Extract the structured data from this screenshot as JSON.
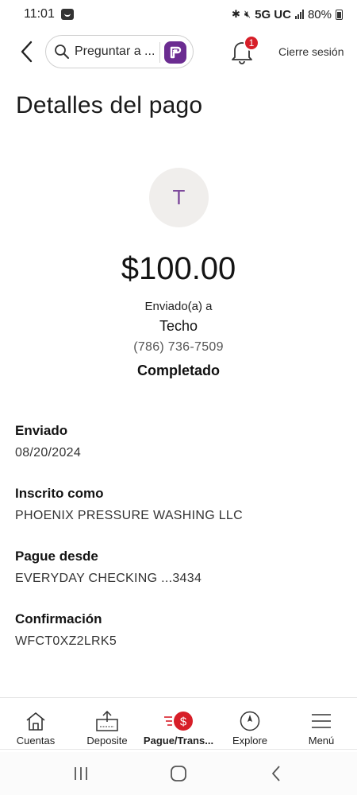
{
  "status_bar": {
    "time": "11:01",
    "network": "5G UC",
    "battery": "80%"
  },
  "app_bar": {
    "search_placeholder": "Preguntar a ...",
    "notification_count": "1",
    "signout_label": "Cierre sesión"
  },
  "page": {
    "title": "Detalles del pago"
  },
  "payment": {
    "avatar_initial": "T",
    "amount": "$100.00",
    "sent_to_label": "Enviado(a) a",
    "recipient_name": "Techo",
    "recipient_phone": "(786) 736-7509",
    "status": "Completado"
  },
  "details": [
    {
      "label": "Enviado",
      "value": "08/20/2024"
    },
    {
      "label": "Inscrito como",
      "value": "PHOENIX PRESSURE WASHING LLC"
    },
    {
      "label": "Pague desde",
      "value": "EVERYDAY CHECKING ...3434"
    },
    {
      "label": "Confirmación",
      "value": "WFCT0XZ2LRK5"
    }
  ],
  "bottom_nav": [
    {
      "label": "Cuentas",
      "icon": "home-icon"
    },
    {
      "label": "Deposite",
      "icon": "deposit-icon"
    },
    {
      "label": "Pague/Trans...",
      "icon": "pay-transfer-icon",
      "active": true
    },
    {
      "label": "Explore",
      "icon": "compass-icon"
    },
    {
      "label": "Menú",
      "icon": "menu-icon"
    }
  ],
  "colors": {
    "brand_red": "#d71e28",
    "brand_purple": "#6b2c91",
    "avatar_text": "#7d4a9c"
  }
}
